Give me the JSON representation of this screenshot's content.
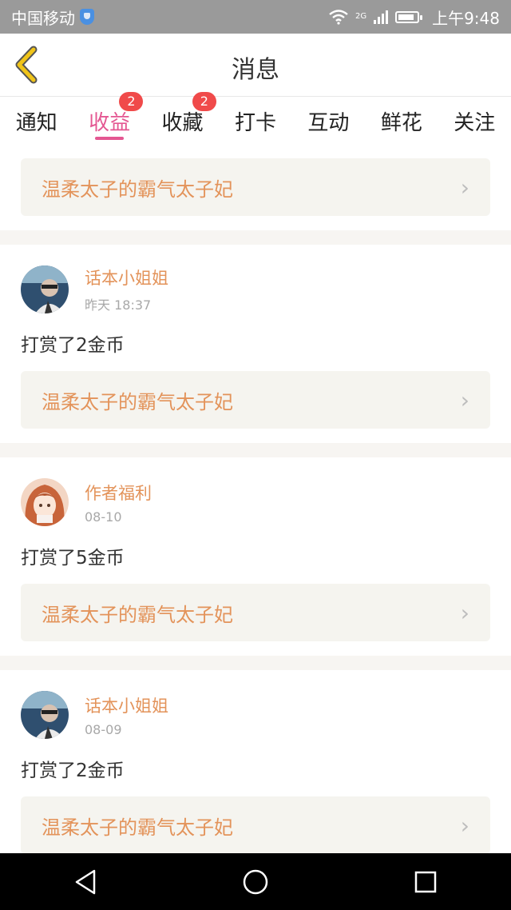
{
  "status_bar": {
    "carrier": "中国移动",
    "network": "2G",
    "time": "上午9:48",
    "battery_level": 0.9
  },
  "header": {
    "title": "消息",
    "back_icon": "chevron-left-icon",
    "accent_color": "#f0c419"
  },
  "tabs": [
    {
      "label": "通知",
      "badge": ""
    },
    {
      "label": "收益",
      "badge": "2",
      "active": true
    },
    {
      "label": "收藏",
      "badge": "2"
    },
    {
      "label": "打卡",
      "badge": ""
    },
    {
      "label": "互动",
      "badge": ""
    },
    {
      "label": "鲜花",
      "badge": ""
    },
    {
      "label": "关注",
      "badge": ""
    }
  ],
  "colors": {
    "active_tab": "#e45792",
    "book_title": "#e3935a",
    "badge": "#f04a4a"
  },
  "top_card": {
    "book_title": "温柔太子的霸气太子妃"
  },
  "messages": [
    {
      "user": "话本小姐姐",
      "time": "昨天 18:37",
      "text": "打赏了2金币",
      "book_title": "温柔太子的霸气太子妃",
      "avatar": "avatar-man-in-car"
    },
    {
      "user": "作者福利",
      "time": "08-10",
      "text": "打赏了5金币",
      "book_title": "温柔太子的霸气太子妃",
      "avatar": "avatar-anime-girl"
    },
    {
      "user": "话本小姐姐",
      "time": "08-09",
      "text": "打赏了2金币",
      "book_title": "温柔太子的霸气太子妃",
      "avatar": "avatar-man-in-car"
    }
  ],
  "nav": [
    "back-triangle-icon",
    "home-circle-icon",
    "recent-square-icon"
  ]
}
